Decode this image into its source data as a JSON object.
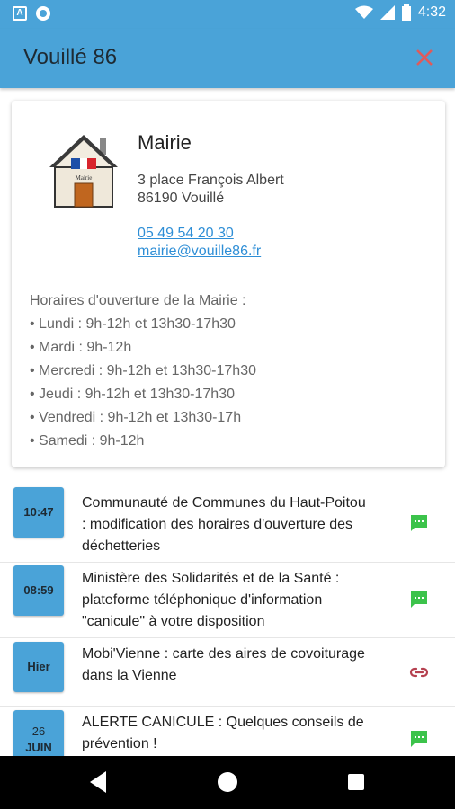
{
  "status_bar": {
    "time": "4:32",
    "left_icons": [
      "a-icon",
      "circle-icon"
    ],
    "right_icons": [
      "wifi-icon",
      "signal-icon",
      "battery-icon"
    ]
  },
  "app_bar": {
    "title": "Vouillé 86"
  },
  "mairie": {
    "name": "Mairie",
    "sign_text": "Mairie",
    "address_line1": "3 place François Albert",
    "address_line2": "86190 Vouillé",
    "phone": "05 49 54 20 30",
    "email": "mairie@vouille86.fr",
    "hours_title": "Horaires d'ouverture de la Mairie :",
    "hours": [
      "• Lundi : 9h-12h et 13h30-17h30",
      "• Mardi : 9h-12h",
      "• Mercredi : 9h-12h et 13h30-17h30",
      "• Jeudi : 9h-12h et 13h30-17h30",
      "• Vendredi : 9h-12h et 13h30-17h",
      "• Samedi : 9h-12h"
    ]
  },
  "news": [
    {
      "time": "10:47",
      "text": "Communauté de Communes du Haut-Poitou : modification des horaires d'ouverture des déchetteries",
      "icon": "message-icon"
    },
    {
      "time": "08:59",
      "text": "Ministère des Solidarités et de la Santé : plateforme téléphonique d'information \"canicule\" à votre disposition",
      "icon": "message-icon"
    },
    {
      "time": "Hier",
      "text": "Mobi'Vienne : carte des aires de covoiturage dans la Vienne",
      "icon": "link-icon"
    },
    {
      "day": "26",
      "month": "JUIN",
      "text": "ALERTE CANICULE : Quelques conseils de prévention !",
      "icon": "message-icon"
    }
  ],
  "colors": {
    "primary": "#4aa3d8",
    "close": "#e05a5a",
    "message_icon": "#3cc34b",
    "link_icon": "#b5404f",
    "link_text": "#2e8ed6"
  }
}
